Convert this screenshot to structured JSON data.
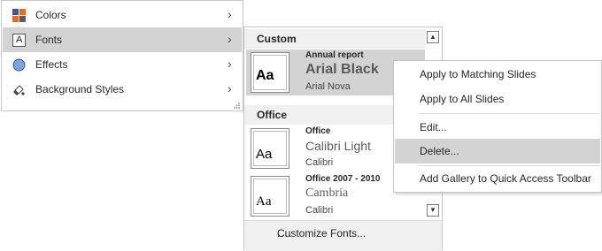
{
  "menu": {
    "items": [
      {
        "label": "Colors",
        "icon": "colors-icon"
      },
      {
        "label": "Fonts",
        "icon": "fonts-icon"
      },
      {
        "label": "Effects",
        "icon": "effects-icon"
      },
      {
        "label": "Background Styles",
        "icon": "background-styles-icon"
      }
    ],
    "selected": "Fonts"
  },
  "gallery": {
    "custom_header": "Custom",
    "office_header": "Office",
    "thumb_text": "Aa",
    "items": [
      {
        "name": "Annual report",
        "heading_font": "Arial Black",
        "body_font": "Arial Nova"
      },
      {
        "name": "Office",
        "heading_font": "Calibri Light",
        "body_font": "Calibri"
      },
      {
        "name": "Office 2007 - 2010",
        "heading_font": "Cambria",
        "body_font": "Calibri"
      }
    ],
    "customize_label": "Customize Fonts...",
    "resize_dots": "....",
    "scroll_up": "▲",
    "scroll_down": "▼"
  },
  "context_menu": {
    "items": [
      "Apply to Matching Slides",
      "Apply to All Slides",
      "Edit...",
      "Delete...",
      "Add Gallery to Quick Access Toolbar"
    ],
    "selected": "Delete..."
  },
  "chevron": "›",
  "colors": {
    "selection": "#d3d3d3",
    "header_bg": "#f0f0f0",
    "border": "#c6c6c6"
  }
}
